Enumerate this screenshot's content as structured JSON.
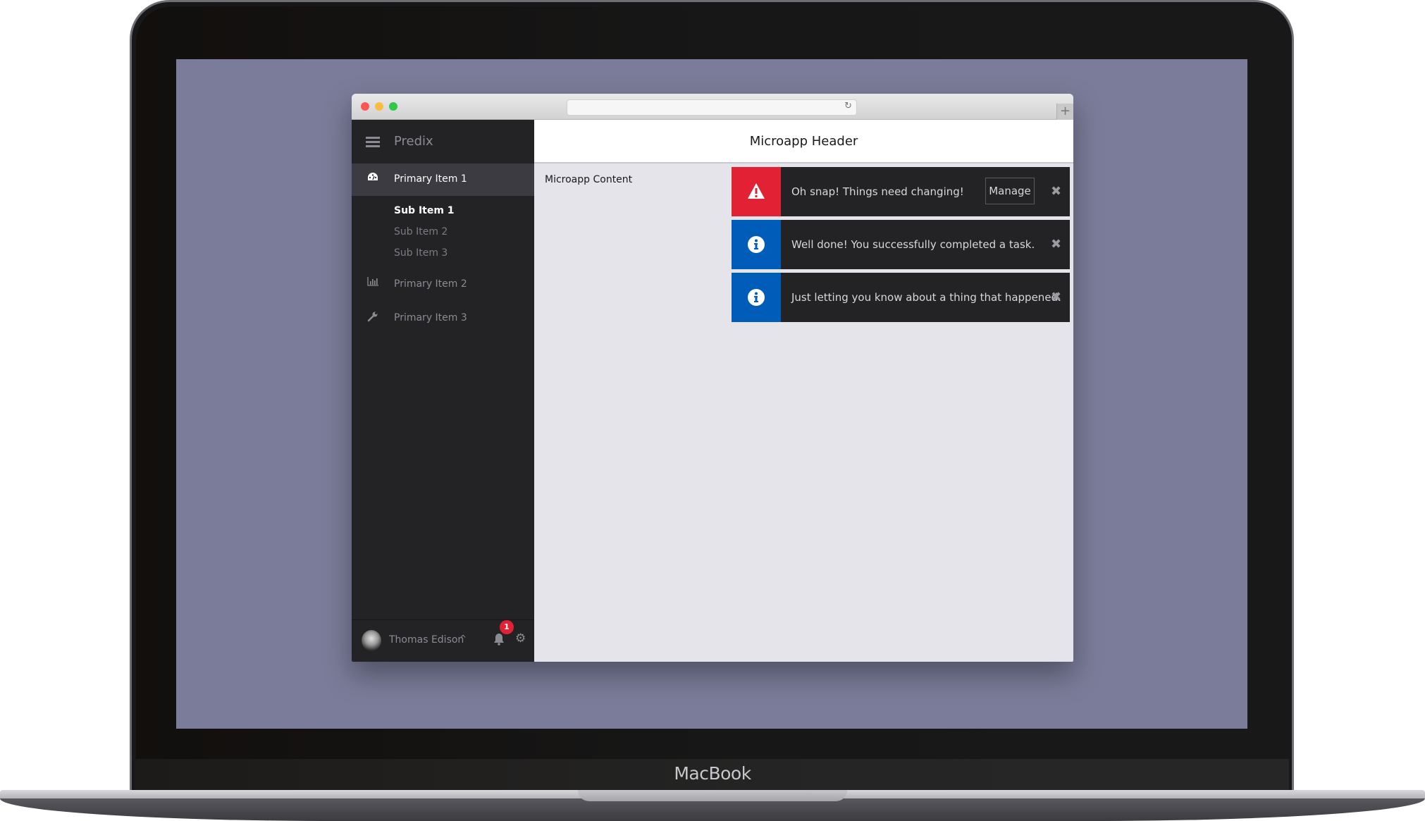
{
  "device": {
    "label": "MacBook"
  },
  "browser": {
    "url": ""
  },
  "sidebar": {
    "brand": "Predix",
    "items": [
      {
        "label": "Primary Item 1",
        "icon": "dashboard-icon",
        "active": true,
        "sub_items": [
          {
            "label": "Sub Item 1",
            "active": true
          },
          {
            "label": "Sub Item 2",
            "active": false
          },
          {
            "label": "Sub Item 3",
            "active": false
          }
        ]
      },
      {
        "label": "Primary Item 2",
        "icon": "bar-chart-icon",
        "active": false
      },
      {
        "label": "Primary Item 3",
        "icon": "wrench-icon",
        "active": false
      }
    ],
    "footer": {
      "user_name": "Thomas Edison",
      "notification_count": "1"
    }
  },
  "main": {
    "header_title": "Microapp Header",
    "content_label": "Microapp Content"
  },
  "toasts": [
    {
      "type": "error",
      "icon": "warning-icon",
      "message": "Oh snap! Things need changing!",
      "action_label": "Manage",
      "color": "#e22134"
    },
    {
      "type": "info",
      "icon": "info-icon",
      "message": "Well done! You successfully completed a task.",
      "color": "#005cb9"
    },
    {
      "type": "info",
      "icon": "info-icon",
      "message": "Just letting you know about a thing that happened.",
      "color": "#005cb9"
    }
  ],
  "colors": {
    "screen_bg": "#7a7c99",
    "sidebar_bg": "#232325",
    "content_bg": "#e4e4ea"
  }
}
